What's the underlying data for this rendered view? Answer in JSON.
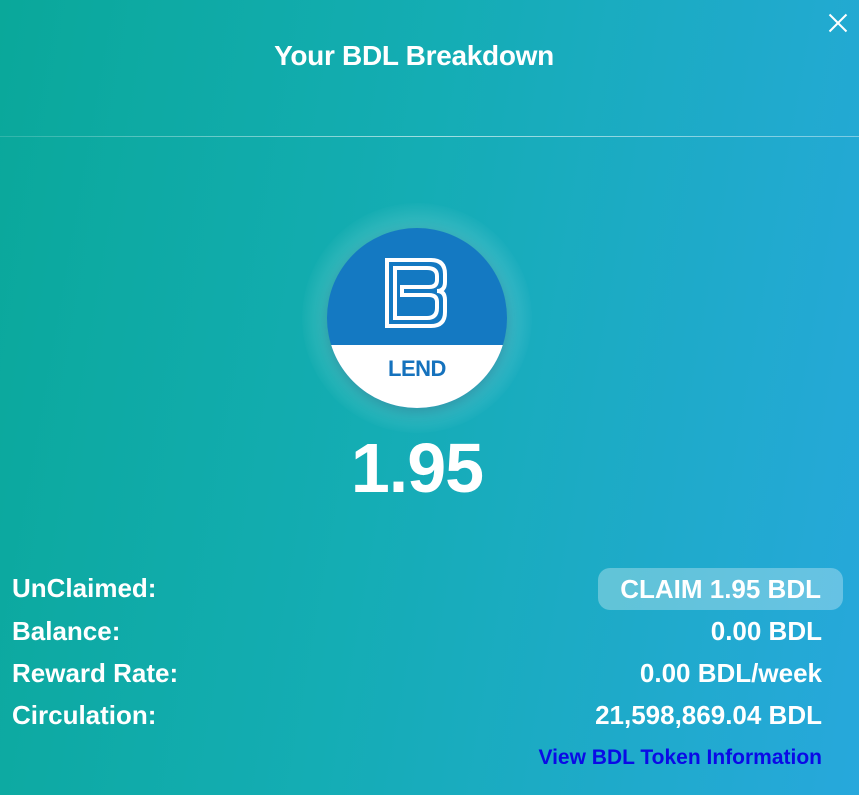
{
  "header": {
    "title": "Your BDL Breakdown"
  },
  "token": {
    "badge_label": "LEND",
    "amount": "1.95",
    "icon": "bdl-logo-icon"
  },
  "details": {
    "unclaimed_label": "UnClaimed:",
    "claim_button_label": "CLAIM 1.95 BDL",
    "balance_label": "Balance:",
    "balance_value": "0.00 BDL",
    "reward_rate_label": "Reward Rate:",
    "reward_rate_value": "0.00 BDL/week",
    "circulation_label": "Circulation:",
    "circulation_value": "21,598,869.04 BDL"
  },
  "links": {
    "token_info": "View BDL Token Information"
  },
  "colors": {
    "gradient_start": "#0aa89a",
    "gradient_end": "#27a8dc",
    "token_blue": "#1479c2",
    "link_blue": "#0a0ae6"
  }
}
